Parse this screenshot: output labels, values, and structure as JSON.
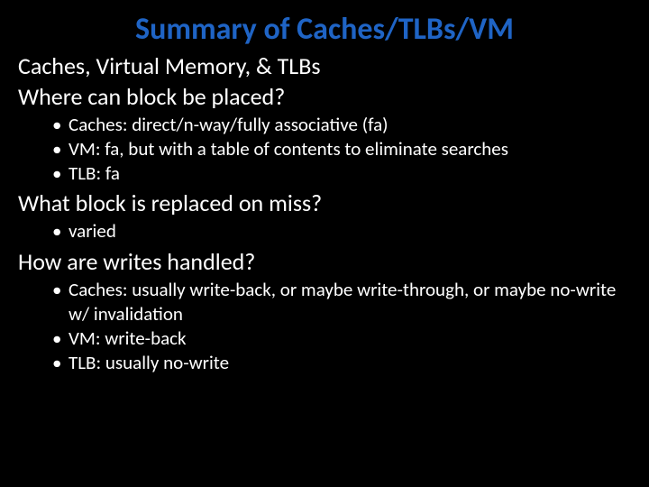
{
  "title": "Summary of Caches/TLBs/VM",
  "section1": "Caches, Virtual Memory, & TLBs",
  "section2": "Where can block be placed?",
  "b1a": "Caches: direct/n-way/fully associative (fa)",
  "b1b": "VM: fa, but with a table of contents to eliminate searches",
  "b1c": "TLB: fa",
  "section3": "What block is replaced on miss?",
  "b2a": "varied",
  "section4": "How are writes handled?",
  "b3a": "Caches: usually write-back, or maybe write-through, or maybe no-write w/ invalidation",
  "b3b": "VM: write-back",
  "b3c": "TLB: usually no-write"
}
